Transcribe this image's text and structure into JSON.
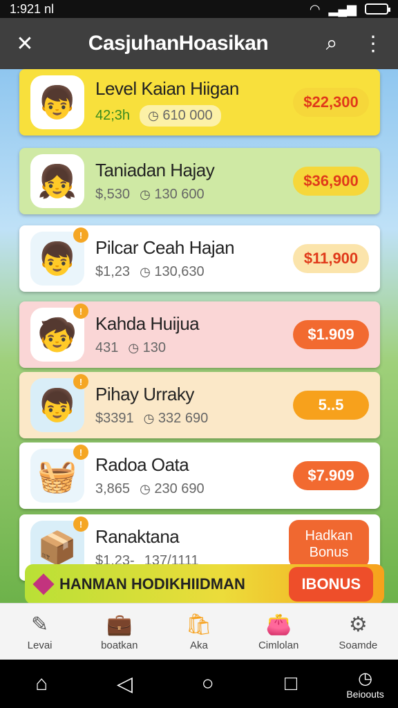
{
  "status": {
    "time": "1:921 nl"
  },
  "app_bar": {
    "title": "CasjuhanHoasikan"
  },
  "cards": [
    {
      "title": "Level Kaian Hiigan",
      "sub1": "42;3h",
      "sub2": "610 000",
      "price": "$22,300",
      "avatar_badge": ""
    },
    {
      "title": "Taniadan Hajay",
      "sub1": "$,530",
      "sub2": "130 600",
      "price": "$36,900",
      "avatar_badge": ""
    },
    {
      "title": "Pilcar Ceah Hajan",
      "sub1": "$1,23",
      "sub2": "130,630",
      "price": "$11,900",
      "avatar_badge": "!"
    },
    {
      "title": "Kahda Huijua",
      "sub1": "431",
      "sub2": "130",
      "price": "$1.909",
      "avatar_badge": "!"
    },
    {
      "title": "Pihay Urraky",
      "sub1": "$3391",
      "sub2": "332 690",
      "price": "5..5",
      "avatar_badge": "!"
    },
    {
      "title": "Radoa Oata",
      "sub1": "3,865",
      "sub2": "230 690",
      "price": "$7.909",
      "avatar_badge": "!"
    },
    {
      "title": "Ranaktana",
      "sub1": "$1,23-",
      "sub2": "137/1111",
      "price": "",
      "avatar_badge": "!"
    }
  ],
  "bonus": {
    "banner_label": "HANMAN HODIKHIIDMAN",
    "button_label": "IBONUS",
    "tag_line1": "Hadkan",
    "tag_line2": "Bonus"
  },
  "tabs": [
    {
      "label": "Levai"
    },
    {
      "label": "boatkan"
    },
    {
      "label": "Aka"
    },
    {
      "label": "Cimlolan"
    },
    {
      "label": "Soamde"
    }
  ],
  "nav": {
    "extra_label": "Beioouts"
  }
}
